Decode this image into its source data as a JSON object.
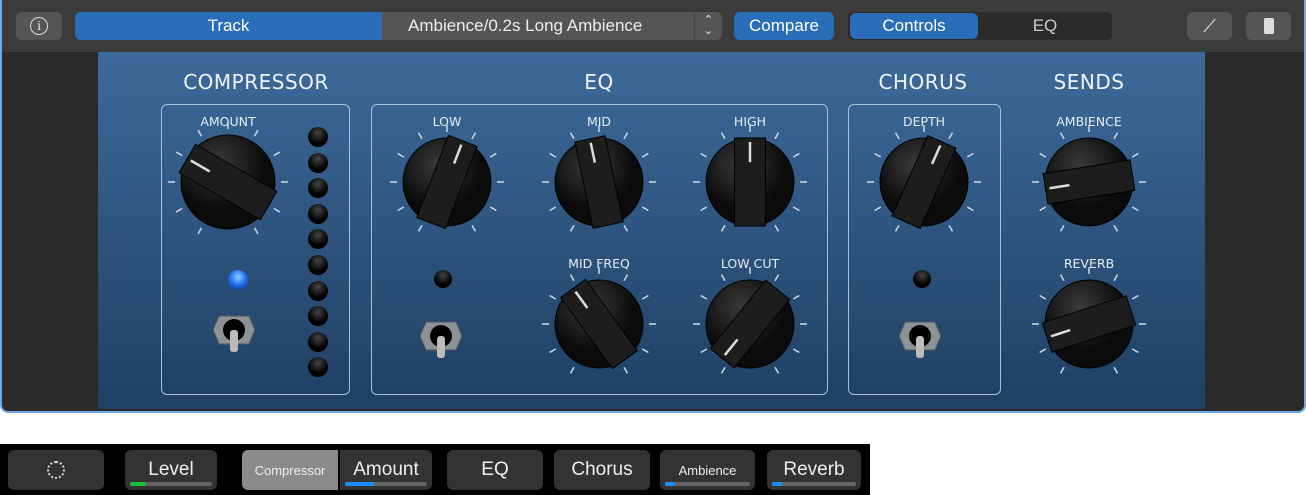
{
  "header": {
    "track": "Track",
    "preset": "Ambience/0.2s Long Ambience",
    "compare": "Compare",
    "tabs": [
      "Controls",
      "EQ"
    ],
    "icons": [
      "info-icon",
      "chevron-updown-icon",
      "wrench-icon",
      "plugin-icon"
    ]
  },
  "sections": {
    "compressor": "COMPRESSOR",
    "eq": "EQ",
    "chorus": "CHORUS",
    "sends": "SENDS"
  },
  "knobs": [
    {
      "id": "amount",
      "label": "AMOUNT",
      "value": 0.3
    },
    {
      "id": "low",
      "label": "LOW",
      "value": 0.57
    },
    {
      "id": "mid",
      "label": "MID",
      "value": 0.46
    },
    {
      "id": "high",
      "label": "HIGH",
      "value": 0.5
    },
    {
      "id": "mid-freq",
      "label": "MID FREQ",
      "value": 0.38
    },
    {
      "id": "low-cut",
      "label": "LOW CUT",
      "value": 0.03
    },
    {
      "id": "depth",
      "label": "DEPTH",
      "value": 0.58
    },
    {
      "id": "ambience",
      "label": "AMBIENCE",
      "value": 0.17
    },
    {
      "id": "reverb",
      "label": "REVERB",
      "value": 0.14
    }
  ],
  "compressor_meter": {
    "leds": 10,
    "lit": 0
  },
  "bottom": {
    "items": [
      {
        "label": "",
        "icon": "knob-icon"
      },
      {
        "label": "Level",
        "level": 0.2,
        "color": "#1fbf3a"
      },
      {
        "label": "Compressor",
        "selected": true
      },
      {
        "label": "Amount",
        "level": 0.35,
        "color": "#1a8cff"
      },
      {
        "label": "EQ"
      },
      {
        "label": "Chorus"
      },
      {
        "label": "Ambience",
        "level": 0.12,
        "color": "#1a8cff"
      },
      {
        "label": "Reverb",
        "level": 0.12,
        "color": "#1a8cff"
      }
    ]
  }
}
